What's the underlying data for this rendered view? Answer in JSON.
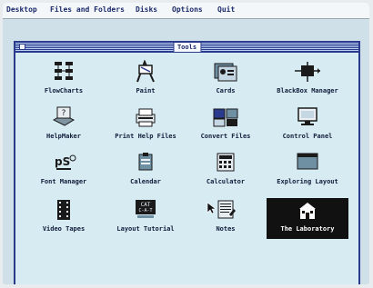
{
  "menubar": {
    "items": [
      "Desktop",
      "Files and Folders",
      "Disks",
      "Options",
      "Quit"
    ]
  },
  "window": {
    "title": "Tools"
  },
  "icons": [
    {
      "label": "FlowCharts",
      "icon": "flowchart-icon"
    },
    {
      "label": "Paint",
      "icon": "paint-easel-icon"
    },
    {
      "label": "Cards",
      "icon": "cards-icon"
    },
    {
      "label": "BlackBox Manager",
      "icon": "blackbox-icon"
    },
    {
      "label": "HelpMaker",
      "icon": "helpmaker-icon"
    },
    {
      "label": "Print Help Files",
      "icon": "printer-icon"
    },
    {
      "label": "Convert Files",
      "icon": "convert-files-icon"
    },
    {
      "label": "Control Panel",
      "icon": "monitor-icon"
    },
    {
      "label": "Font Manager",
      "icon": "font-manager-icon"
    },
    {
      "label": "Calendar",
      "icon": "calendar-icon"
    },
    {
      "label": "Calculator",
      "icon": "calculator-icon"
    },
    {
      "label": "Exploring Layout",
      "icon": "layout-icon"
    },
    {
      "label": "Video Tapes",
      "icon": "film-icon"
    },
    {
      "label": "Layout Tutorial",
      "icon": "tutorial-icon"
    },
    {
      "label": "Notes",
      "icon": "notes-icon"
    },
    {
      "label": "The Laboratory",
      "icon": "laboratory-icon",
      "selected": true
    }
  ],
  "colors": {
    "accent": "#2a3a8c",
    "window_bg": "#d7ebf2",
    "selection": "#111111"
  }
}
